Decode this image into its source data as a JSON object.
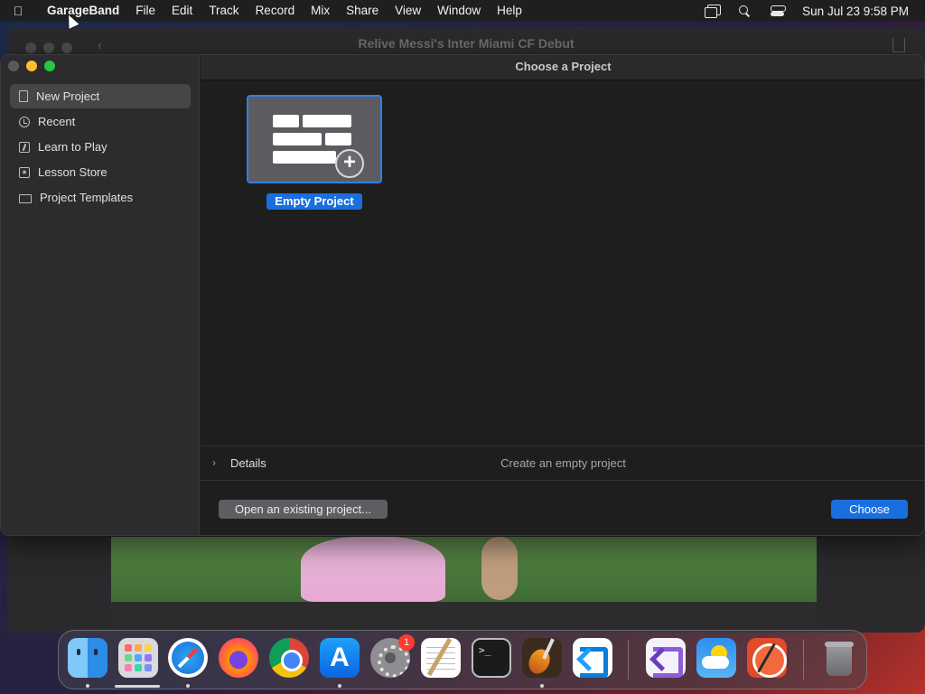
{
  "menubar": {
    "apple": "",
    "app_name": "GarageBand",
    "menus": [
      "File",
      "Edit",
      "Track",
      "Record",
      "Mix",
      "Share",
      "View",
      "Window",
      "Help"
    ],
    "clock": "Sun Jul 23  9:58 PM",
    "status_icons": [
      "screen-mirroring-icon",
      "search-icon",
      "control-center-icon"
    ]
  },
  "background_window": {
    "title": "Relive Messi's Inter Miami CF Debut"
  },
  "dialog": {
    "title": "Choose a Project",
    "sidebar": {
      "items": [
        {
          "label": "New Project",
          "icon": "document-icon",
          "selected": true
        },
        {
          "label": "Recent",
          "icon": "clock-icon",
          "selected": false
        },
        {
          "label": "Learn to Play",
          "icon": "learn-icon",
          "selected": false
        },
        {
          "label": "Lesson Store",
          "icon": "star-icon",
          "selected": false
        },
        {
          "label": "Project Templates",
          "icon": "folder-icon",
          "selected": false
        }
      ]
    },
    "project": {
      "label": "Empty Project",
      "icon": "plus-icon"
    },
    "details": {
      "label": "Details",
      "description": "Create an empty project"
    },
    "buttons": {
      "open_existing": "Open an existing project...",
      "choose": "Choose"
    }
  },
  "dock": {
    "apps": [
      "Finder",
      "Launchpad",
      "Safari",
      "Firefox",
      "Google Chrome",
      "App Store",
      "System Settings",
      "TextEdit",
      "Terminal",
      "GarageBand",
      "Visual Studio Code",
      "Visual Studio",
      "Weather",
      "Instruments",
      "Trash"
    ],
    "settings_badge": "1",
    "terminal_glyph": ">_"
  },
  "colors": {
    "accent": "#1a6fe0",
    "selection": "#464648",
    "close": "#5a5a5c",
    "minimize": "#febc2e",
    "maximize": "#28c840"
  }
}
